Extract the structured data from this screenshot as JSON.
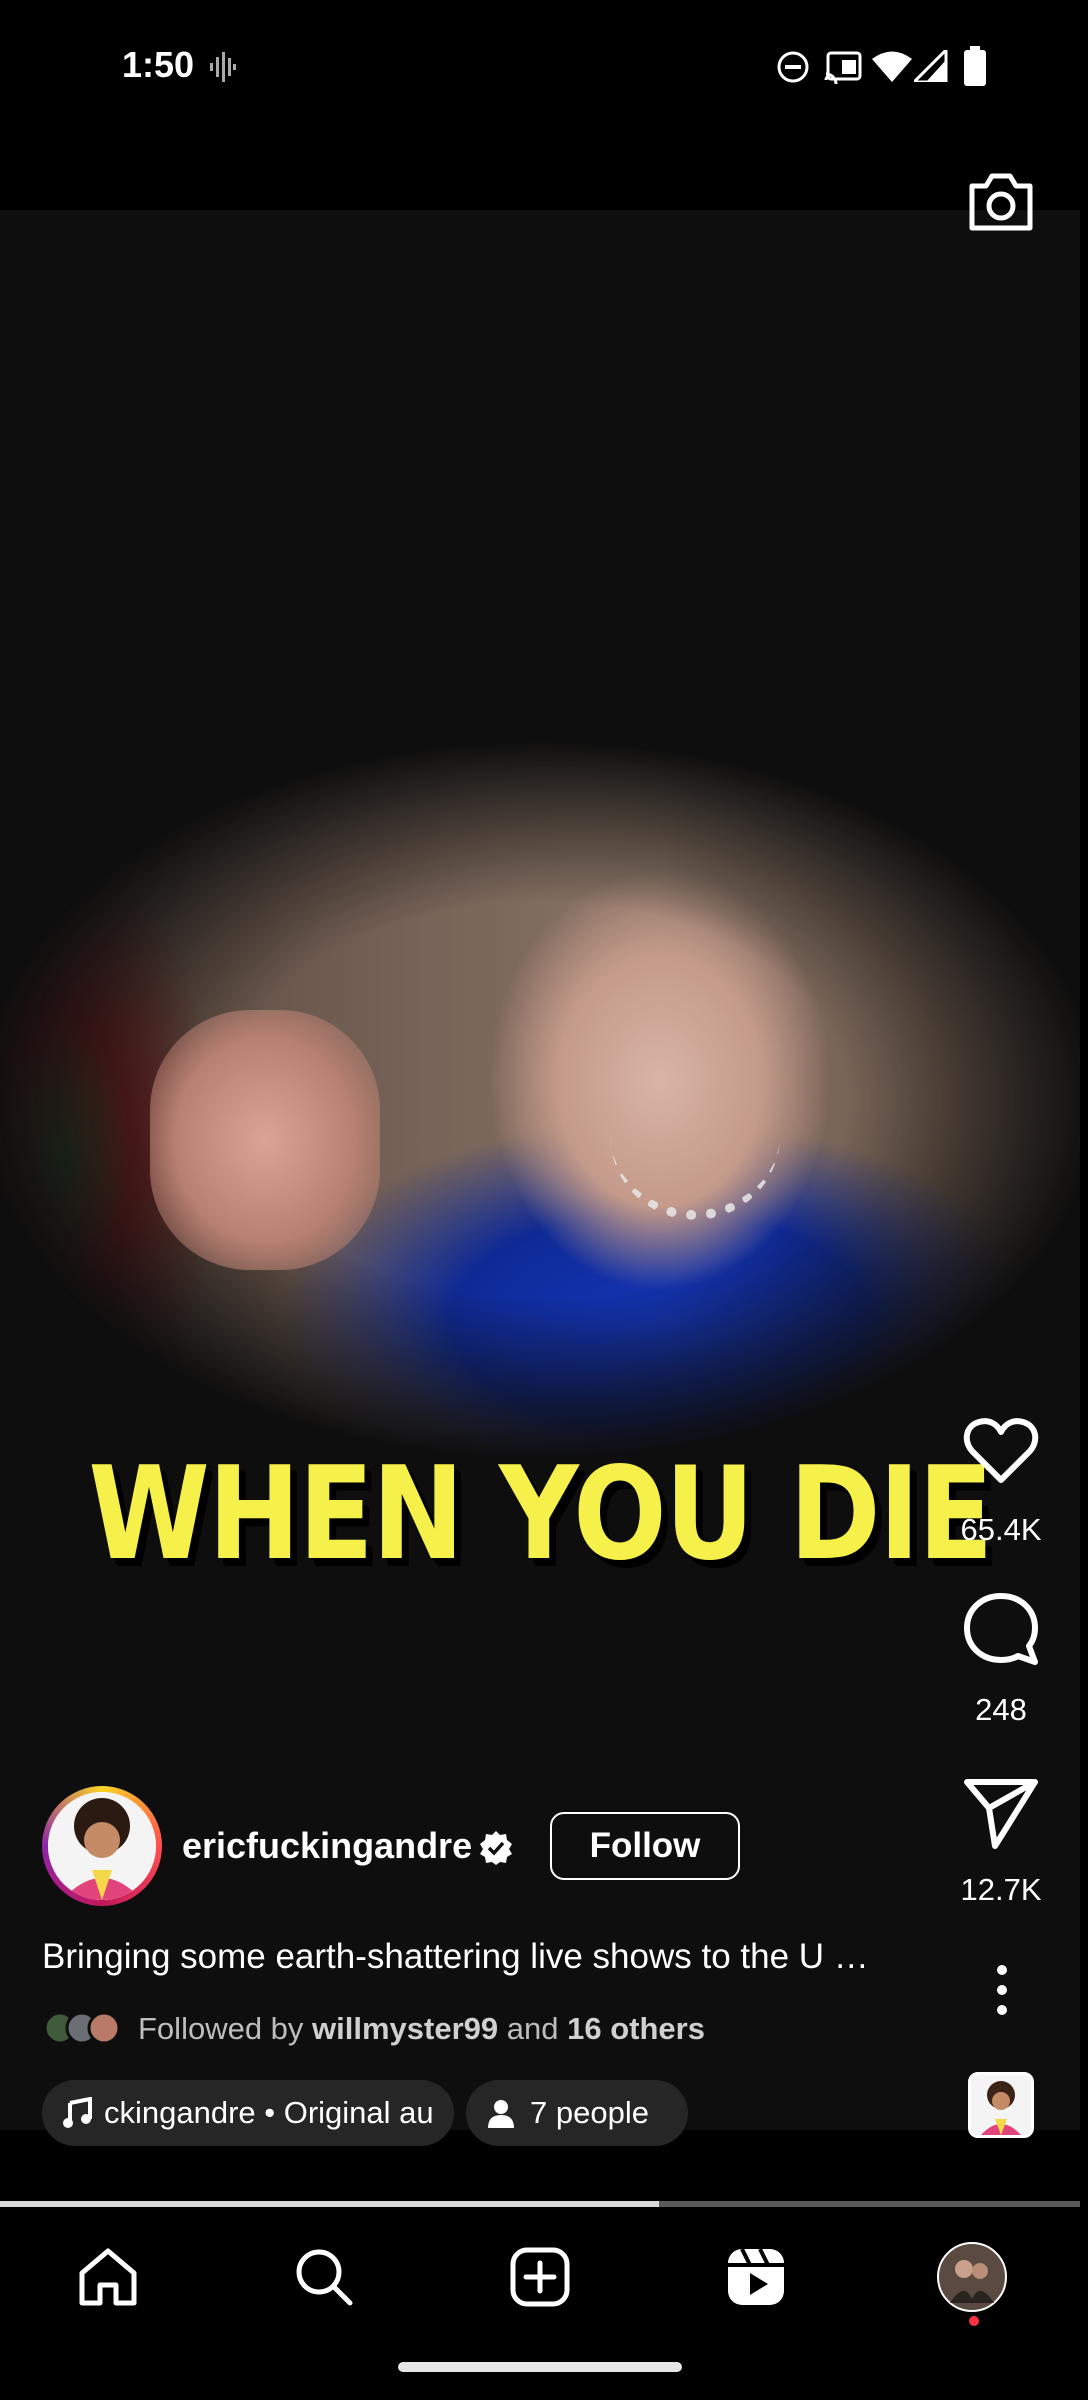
{
  "status_bar": {
    "time": "1:50",
    "icons": [
      "voice-wave-icon",
      "dnd-icon",
      "cast-icon",
      "wifi-icon",
      "signal-icon",
      "battery-icon"
    ]
  },
  "header": {
    "camera_icon": "camera-icon"
  },
  "video": {
    "overlay_text": "WHEN YOU DIE"
  },
  "actions": {
    "likes": "65.4K",
    "comments": "248",
    "shares": "12.7K"
  },
  "author": {
    "username": "ericfuckingandre",
    "verified": true,
    "follow_label": "Follow"
  },
  "caption": "Bringing some earth-shattering live shows to the U …",
  "followed_by": {
    "prefix": "Followed by",
    "user": "willmyster99",
    "middle": "and",
    "others": "16 others"
  },
  "audio": {
    "label": "ckingandre • Original au"
  },
  "people_tag": {
    "label": "7 people"
  },
  "progress": {
    "fraction": 0.61
  },
  "bottom_nav": {
    "items": [
      "home-icon",
      "search-icon",
      "create-icon",
      "reels-icon",
      "profile-avatar"
    ],
    "active": "reels-icon",
    "profile_notification": true
  },
  "colors": {
    "caption_yellow": "#f5f04a",
    "notification_dot": "#ff3040",
    "pill_bg": "#262626"
  }
}
